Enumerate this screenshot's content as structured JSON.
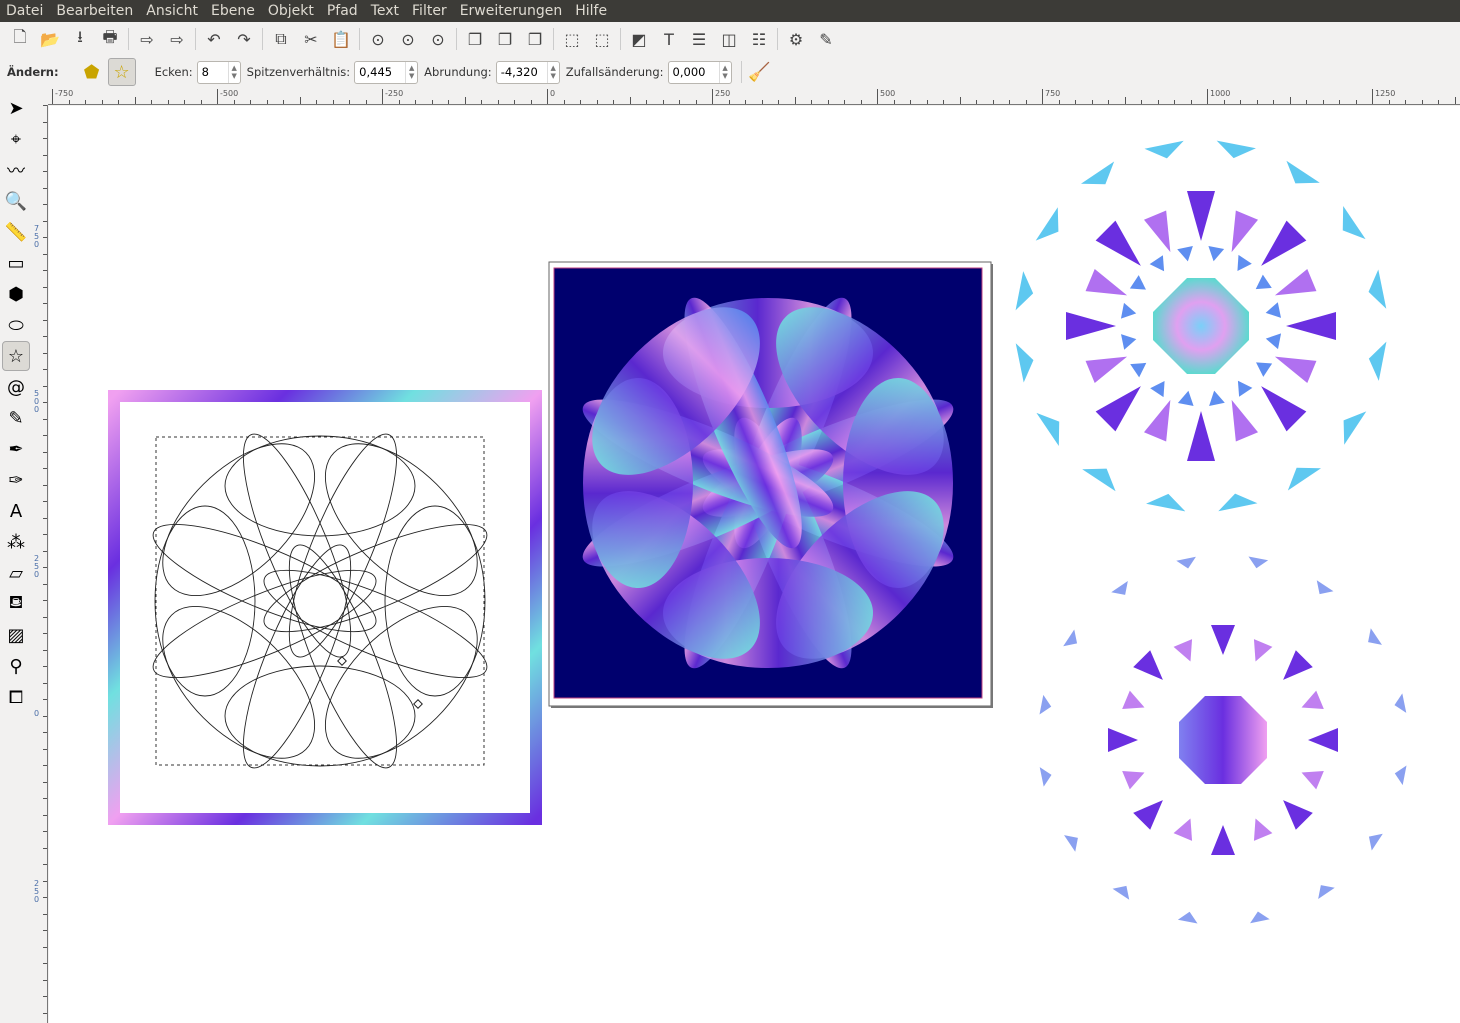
{
  "menu": [
    "Datei",
    "Bearbeiten",
    "Ansicht",
    "Ebene",
    "Objekt",
    "Pfad",
    "Text",
    "Filter",
    "Erweiterungen",
    "Hilfe"
  ],
  "toolbar_icons": [
    "new-document-icon",
    "open-icon",
    "save-icon",
    "print-icon",
    "|",
    "import-icon",
    "export-icon",
    "|",
    "undo-icon",
    "redo-icon",
    "|",
    "copy-icon",
    "cut-icon",
    "paste-icon",
    "|",
    "zoom-selection-icon",
    "zoom-drawing-icon",
    "zoom-page-icon",
    "|",
    "duplicate-icon",
    "clone-icon",
    "unlink-clone-icon",
    "|",
    "group-icon",
    "ungroup-icon",
    "|",
    "fill-stroke-icon",
    "text-font-icon",
    "layers-icon",
    "xml-editor-icon",
    "align-icon",
    "|",
    "preferences-icon",
    "document-properties-icon"
  ],
  "toolbar_glyphs": [
    "🗋",
    "📂",
    "⭳",
    "🖶",
    "|",
    "⇨",
    "⇨",
    "|",
    "↶",
    "↷",
    "|",
    "⧉",
    "✂",
    "📋",
    "|",
    "⊙",
    "⊙",
    "⊙",
    "|",
    "❐",
    "❐",
    "❐",
    "|",
    "⬚",
    "⬚",
    "|",
    "◩",
    "T",
    "☰",
    "◫",
    "☷",
    "|",
    "⚙",
    "✎"
  ],
  "controls": {
    "label": "Ändern:",
    "corners_label": "Ecken:",
    "corners": "8",
    "ratio_label": "Spitzenverhältnis:",
    "ratio": "0,445",
    "rounded_label": "Abrundung:",
    "rounded": "-4,320",
    "random_label": "Zufallsänderung:",
    "random": "0,000"
  },
  "ruler_h": [
    "-750",
    "-500",
    "-250",
    "0",
    "250",
    "500",
    "750",
    "1000",
    "1250"
  ],
  "ruler_v": [
    "750",
    "500",
    "250",
    "0",
    "250"
  ],
  "tools": [
    {
      "name": "selector-tool",
      "g": "➤"
    },
    {
      "name": "node-tool",
      "g": "⌖"
    },
    {
      "name": "tweak-tool",
      "g": "〰"
    },
    {
      "name": "zoom-tool",
      "g": "🔍"
    },
    {
      "name": "measure-tool",
      "g": "📏"
    },
    {
      "name": "rectangle-tool",
      "g": "▭"
    },
    {
      "name": "3d-box-tool",
      "g": "⬢"
    },
    {
      "name": "ellipse-tool",
      "g": "⬭"
    },
    {
      "name": "star-tool",
      "g": "☆",
      "active": true
    },
    {
      "name": "spiral-tool",
      "g": "@"
    },
    {
      "name": "pencil-tool",
      "g": "✎"
    },
    {
      "name": "pen-tool",
      "g": "✒"
    },
    {
      "name": "calligraphy-tool",
      "g": "✑"
    },
    {
      "name": "text-tool",
      "g": "A"
    },
    {
      "name": "spray-tool",
      "g": "⁂"
    },
    {
      "name": "eraser-tool",
      "g": "▱"
    },
    {
      "name": "paint-bucket-tool",
      "g": "⛾"
    },
    {
      "name": "gradient-tool",
      "g": "▨"
    },
    {
      "name": "dropper-tool",
      "g": "⚲"
    },
    {
      "name": "connector-tool",
      "g": "⧠"
    }
  ],
  "colors": {
    "navy": "#00006e",
    "violet": "#6a2fe0",
    "pink": "#f0a0f0",
    "cyan": "#70e0e0",
    "sky": "#5ec8f0"
  }
}
